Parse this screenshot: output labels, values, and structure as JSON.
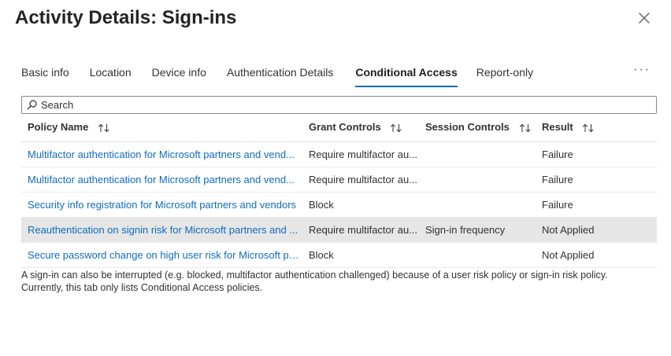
{
  "title": "Activity Details: Sign-ins",
  "tabs": [
    {
      "label": "Basic info"
    },
    {
      "label": "Location"
    },
    {
      "label": "Device info"
    },
    {
      "label": "Authentication Details"
    },
    {
      "label": "Conditional Access",
      "active": true
    },
    {
      "label": "Report-only"
    }
  ],
  "more_label": "···",
  "search": {
    "placeholder": "Search",
    "value": ""
  },
  "table": {
    "headers": {
      "policy_name": "Policy Name",
      "grant_controls": "Grant Controls",
      "session_controls": "Session Controls",
      "result": "Result"
    },
    "rows": [
      {
        "policy_name": "Multifactor authentication for Microsoft partners and vend...",
        "grant_controls": "Require multifactor au...",
        "session_controls": "",
        "result": "Failure"
      },
      {
        "policy_name": "Multifactor authentication for Microsoft partners and vend...",
        "grant_controls": "Require multifactor au...",
        "session_controls": "",
        "result": "Failure"
      },
      {
        "policy_name": "Security info registration for Microsoft partners and vendors",
        "grant_controls": "Block",
        "session_controls": "",
        "result": "Failure"
      },
      {
        "policy_name": "Reauthentication on signin risk for Microsoft partners and ...",
        "grant_controls": "Require multifactor au...",
        "session_controls": "Sign-in frequency",
        "result": "Not Applied",
        "selected": true
      },
      {
        "policy_name": "Secure password change on high user risk for Microsoft pa...",
        "grant_controls": "Block",
        "session_controls": "",
        "result": "Not Applied"
      }
    ]
  },
  "note": {
    "line1": "A sign-in can also be interrupted (e.g. blocked, multifactor authentication challenged) because of a user risk policy or sign-in risk policy.",
    "line2": "Currently, this tab only lists Conditional Access policies."
  },
  "colors": {
    "accent": "#0f6cbd",
    "selected_row": "#e6e6e6",
    "text": "#323130"
  }
}
